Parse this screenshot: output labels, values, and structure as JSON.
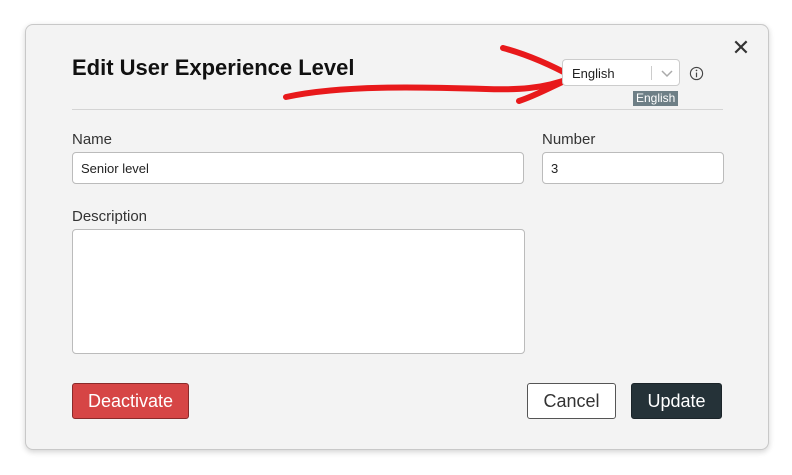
{
  "dialog": {
    "title": "Edit User Experience Level",
    "close_icon": "close-icon"
  },
  "language": {
    "selected": "English",
    "tooltip": "English",
    "info_icon": "info-icon",
    "chevron_icon": "chevron-down-icon"
  },
  "form": {
    "name_label": "Name",
    "name_value": "Senior level",
    "number_label": "Number",
    "number_value": "3",
    "description_label": "Description",
    "description_value": ""
  },
  "buttons": {
    "deactivate": "Deactivate",
    "cancel": "Cancel",
    "update": "Update"
  },
  "colors": {
    "deactivate": "#d64545",
    "update": "#253238",
    "annotation_arrow": "#e8191b"
  }
}
